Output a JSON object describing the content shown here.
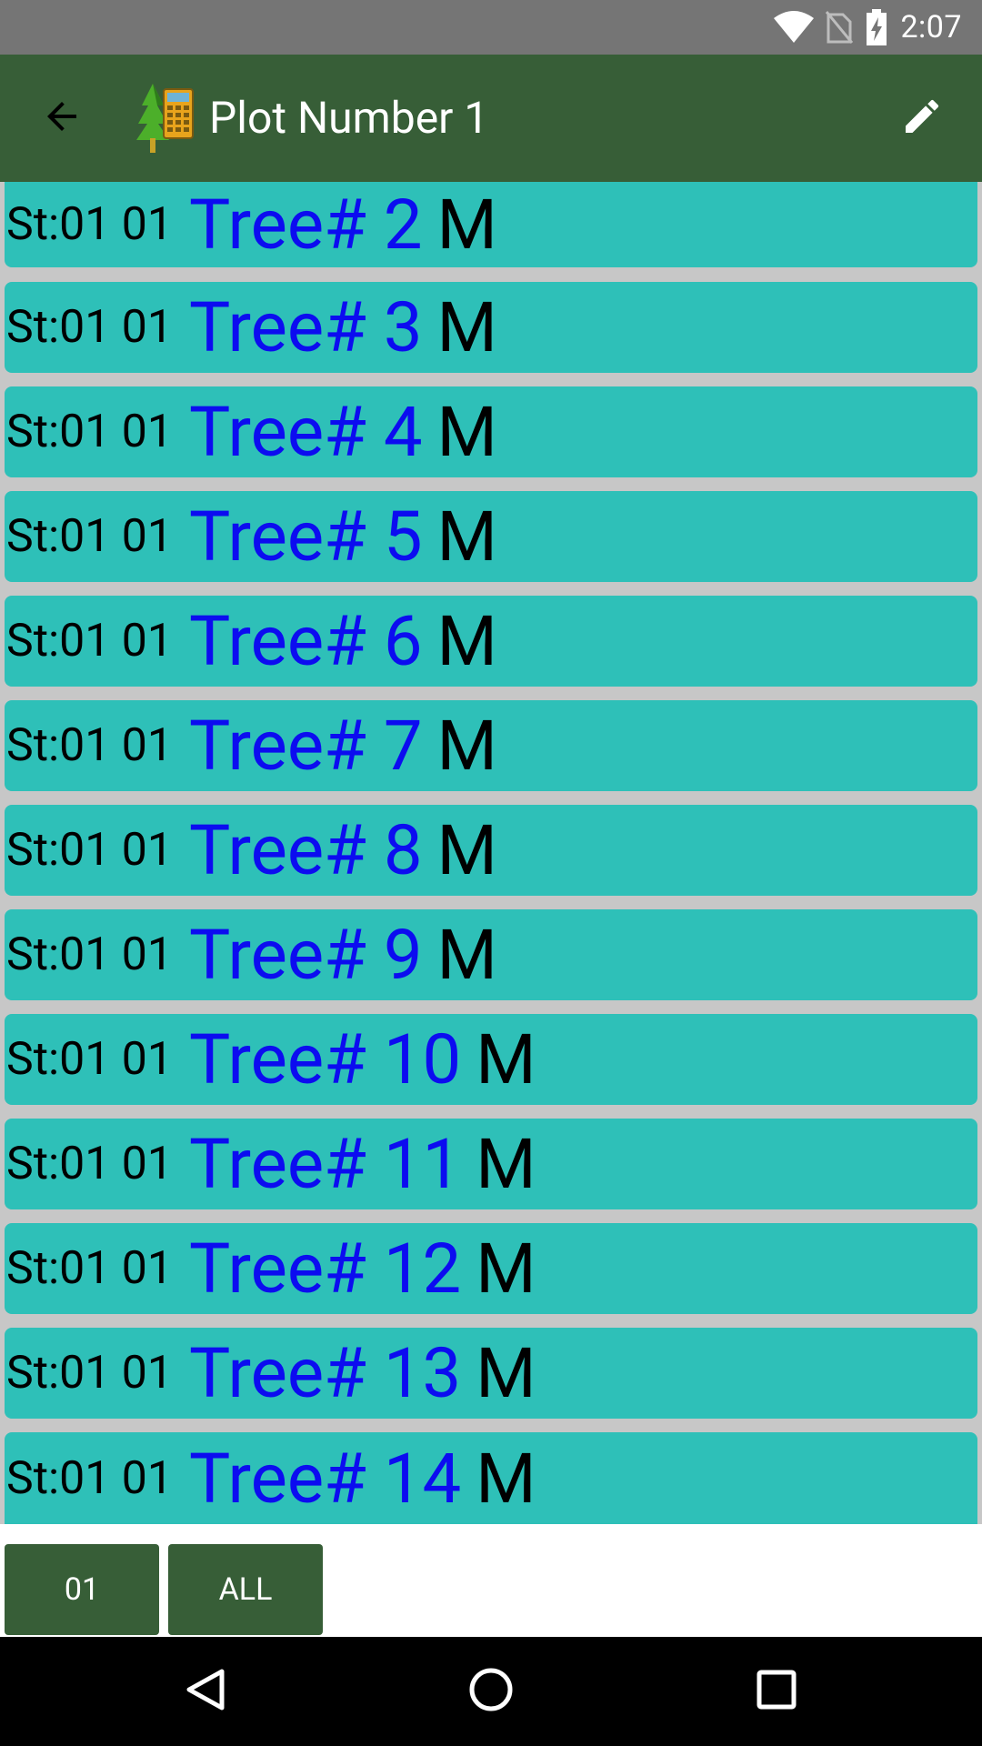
{
  "status_bar": {
    "time": "2:07",
    "icons": [
      "wifi-icon",
      "no-sim-icon",
      "battery-charging-icon"
    ]
  },
  "app_bar": {
    "title": "Plot Number 1",
    "back_icon": "arrow-back-icon",
    "logo": "tree-calculator-logo",
    "edit_icon": "pencil-edit-icon"
  },
  "tree_list": {
    "items": [
      {
        "prefix": "St:01 01",
        "tree": "Tree# 2",
        "status": "M"
      },
      {
        "prefix": "St:01 01",
        "tree": "Tree# 3",
        "status": "M"
      },
      {
        "prefix": "St:01 01",
        "tree": "Tree# 4",
        "status": "M"
      },
      {
        "prefix": "St:01 01",
        "tree": "Tree# 5",
        "status": "M"
      },
      {
        "prefix": "St:01 01",
        "tree": "Tree# 6",
        "status": "M"
      },
      {
        "prefix": "St:01 01",
        "tree": "Tree# 7",
        "status": "M"
      },
      {
        "prefix": "St:01 01",
        "tree": "Tree# 8",
        "status": "M"
      },
      {
        "prefix": "St:01 01",
        "tree": "Tree# 9",
        "status": "M"
      },
      {
        "prefix": "St:01 01",
        "tree": "Tree# 10",
        "status": "M"
      },
      {
        "prefix": "St:01 01",
        "tree": "Tree# 11",
        "status": "M"
      },
      {
        "prefix": "St:01 01",
        "tree": "Tree# 12",
        "status": "M"
      },
      {
        "prefix": "St:01 01",
        "tree": "Tree# 13",
        "status": "M"
      },
      {
        "prefix": "St:01 01",
        "tree": "Tree# 14",
        "status": "M"
      }
    ]
  },
  "bottom_bar": {
    "buttons": [
      {
        "label": "01"
      },
      {
        "label": "ALL"
      }
    ]
  },
  "nav_bar": {
    "icons": [
      "nav-back-icon",
      "nav-home-icon",
      "nav-recents-icon"
    ]
  },
  "colors": {
    "status_bar": "#757575",
    "app_bar": "#375e37",
    "list_background": "#c7c7c7",
    "row_background": "#2ec0b8",
    "tree_text": "#0c0cf0",
    "button": "#375e37"
  }
}
